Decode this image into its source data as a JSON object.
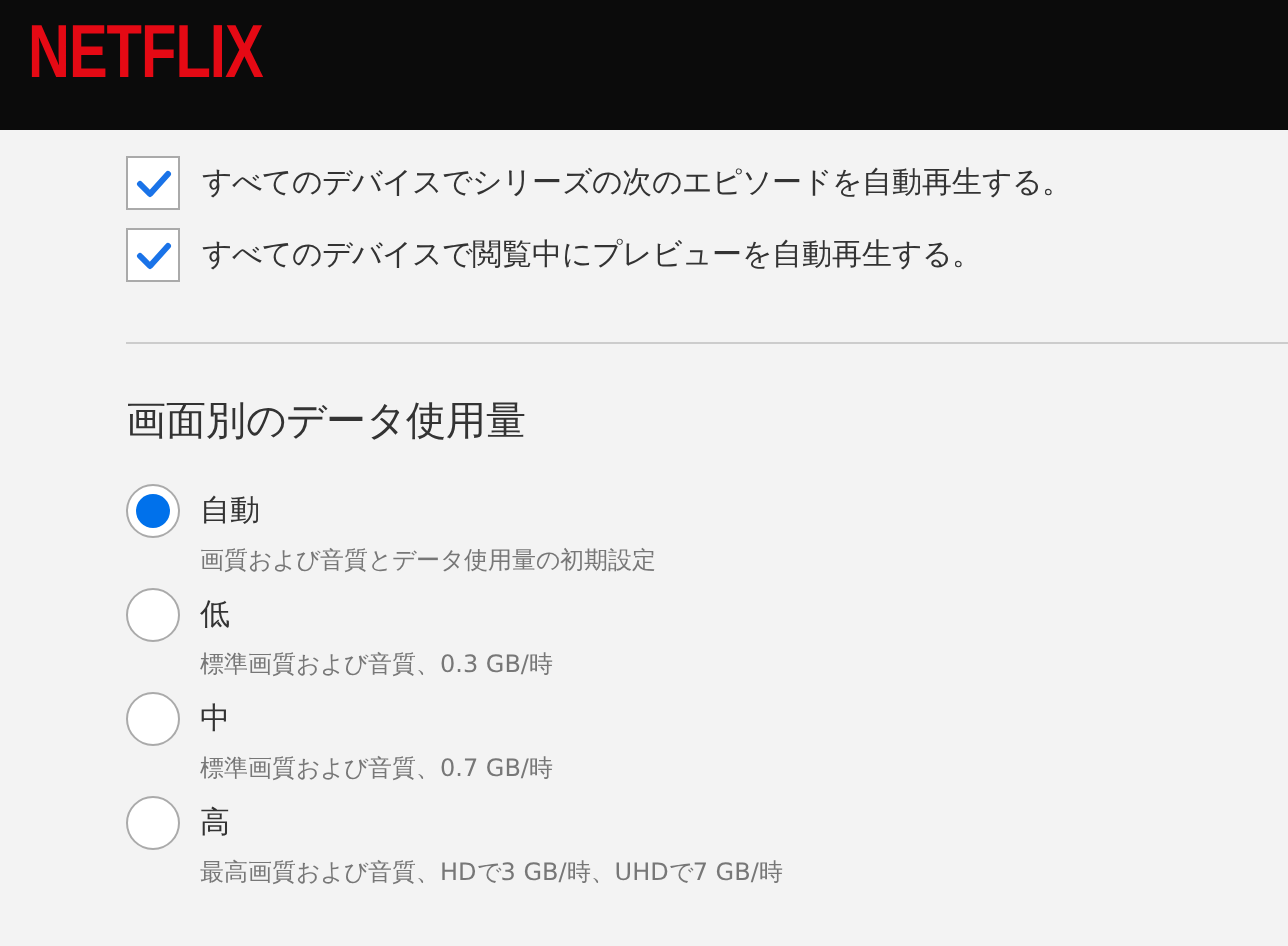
{
  "header": {
    "logo": "NETFLIX"
  },
  "autoplay": [
    {
      "label": "すべてのデバイスでシリーズの次のエピソードを自動再生する。",
      "checked": true
    },
    {
      "label": "すべてのデバイスで閲覧中にプレビューを自動再生する。",
      "checked": true
    }
  ],
  "data_usage": {
    "title": "画面別のデータ使用量",
    "options": [
      {
        "label": "自動",
        "description": "画質および音質とデータ使用量の初期設定",
        "selected": true
      },
      {
        "label": "低",
        "description": "標準画質および音質、0.3 GB/時",
        "selected": false
      },
      {
        "label": "中",
        "description": "標準画質および音質、0.7 GB/時",
        "selected": false
      },
      {
        "label": "高",
        "description": "最高画質および音質、HDで3 GB/時、UHDで7 GB/時",
        "selected": false
      }
    ]
  }
}
